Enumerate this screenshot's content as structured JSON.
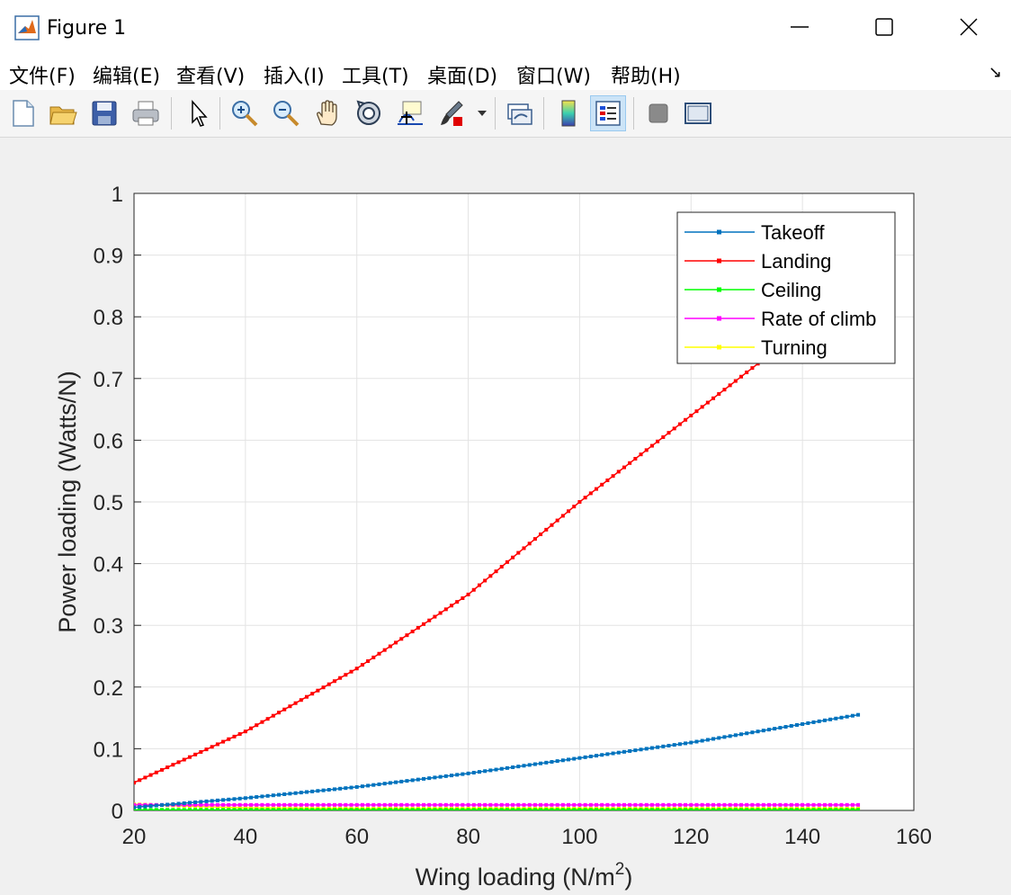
{
  "window": {
    "title": "Figure 1"
  },
  "menu": [
    "文件(F)",
    "编辑(E)",
    "查看(V)",
    "插入(I)",
    "工具(T)",
    "桌面(D)",
    "窗口(W)",
    "帮助(H)"
  ],
  "toolbar": {
    "icons": [
      "new-figure-icon",
      "open-file-icon",
      "save-icon",
      "print-icon",
      "select-arrow-icon",
      "zoom-in-icon",
      "zoom-out-icon",
      "pan-hand-icon",
      "rotate-3d-icon",
      "data-cursor-icon",
      "brush-icon",
      "link-plot-icon",
      "colorbar-icon",
      "legend-icon",
      "hide-plot-tools-icon",
      "show-plot-tools-icon"
    ]
  },
  "chart_data": {
    "type": "line",
    "xlabel": "Wing loading (N/m",
    "xlabel_sup": "2",
    "xlabel_end": ")",
    "ylabel": "Power loading (Watts/N)",
    "xlim": [
      20,
      160
    ],
    "ylim": [
      0,
      1
    ],
    "xticks": [
      20,
      40,
      60,
      80,
      100,
      120,
      140,
      160
    ],
    "yticks": [
      0,
      0.1,
      0.2,
      0.3,
      0.4,
      0.5,
      0.6,
      0.7,
      0.8,
      0.9,
      1
    ],
    "ytick_labels": [
      "0",
      "0.1",
      "0.2",
      "0.3",
      "0.4",
      "0.5",
      "0.6",
      "0.7",
      "0.8",
      "0.9",
      "1"
    ],
    "grid": true,
    "legend_position": "top-right",
    "x": [
      20,
      40,
      60,
      80,
      100,
      120,
      150
    ],
    "series": [
      {
        "name": "Takeoff",
        "color": "#0072bd",
        "values": [
          0.005,
          0.02,
          0.038,
          0.06,
          0.085,
          0.11,
          0.155
        ]
      },
      {
        "name": "Landing",
        "color": "#ff0000",
        "values": [
          0.045,
          0.128,
          0.23,
          0.35,
          0.5,
          0.64,
          0.85
        ]
      },
      {
        "name": "Ceiling",
        "color": "#00ff00",
        "values": [
          0.001,
          0.001,
          0.001,
          0.001,
          0.001,
          0.001,
          0.001
        ]
      },
      {
        "name": "Rate of climb",
        "color": "#ff00ff",
        "values": [
          0.009,
          0.009,
          0.009,
          0.009,
          0.009,
          0.009,
          0.009
        ]
      },
      {
        "name": "Turning",
        "color": "#ffff00",
        "values": [
          0.01,
          0.004,
          0.003,
          0.003,
          0.003,
          0.003,
          0.003
        ]
      }
    ]
  }
}
